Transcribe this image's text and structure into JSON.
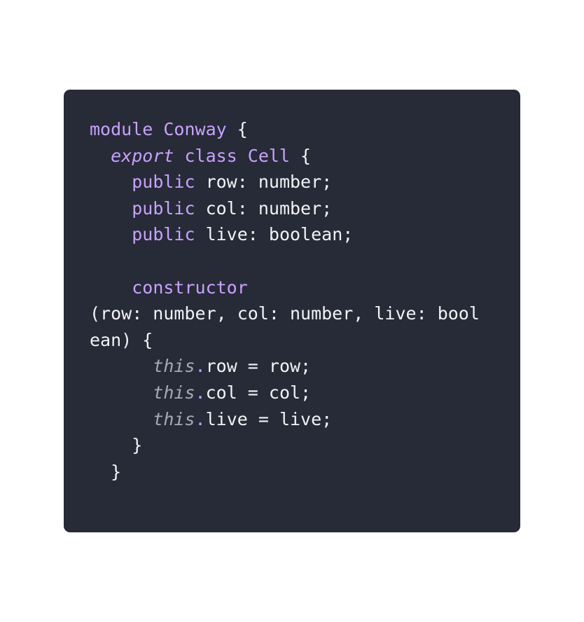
{
  "code": {
    "language": "typescript",
    "lines": [
      [
        {
          "t": "module",
          "c": "kw"
        },
        {
          "t": " ",
          "c": "plain"
        },
        {
          "t": "Conway",
          "c": "kw"
        },
        {
          "t": " {",
          "c": "plain"
        }
      ],
      [
        {
          "t": "  ",
          "c": "plain"
        },
        {
          "t": "export",
          "c": "kw-italic"
        },
        {
          "t": " class ",
          "c": "kw"
        },
        {
          "t": "Cell",
          "c": "kw"
        },
        {
          "t": " {",
          "c": "plain"
        }
      ],
      [
        {
          "t": "    ",
          "c": "plain"
        },
        {
          "t": "public",
          "c": "kw"
        },
        {
          "t": " row: number;",
          "c": "plain"
        }
      ],
      [
        {
          "t": "    ",
          "c": "plain"
        },
        {
          "t": "public",
          "c": "kw"
        },
        {
          "t": " col: number;",
          "c": "plain"
        }
      ],
      [
        {
          "t": "    ",
          "c": "plain"
        },
        {
          "t": "public",
          "c": "kw"
        },
        {
          "t": " live: boolean;",
          "c": "plain"
        }
      ],
      [],
      [
        {
          "t": "    ",
          "c": "plain"
        },
        {
          "t": "constructor",
          "c": "kw"
        }
      ],
      [
        {
          "t": "(row: number, col: number, live: bool",
          "c": "plain"
        }
      ],
      [
        {
          "t": "ean) {",
          "c": "plain"
        }
      ],
      [
        {
          "t": "      ",
          "c": "plain"
        },
        {
          "t": "this",
          "c": "this"
        },
        {
          "t": ".",
          "c": "dot"
        },
        {
          "t": "row = row;",
          "c": "plain"
        }
      ],
      [
        {
          "t": "      ",
          "c": "plain"
        },
        {
          "t": "this",
          "c": "this"
        },
        {
          "t": ".",
          "c": "dot"
        },
        {
          "t": "col = col;",
          "c": "plain"
        }
      ],
      [
        {
          "t": "      ",
          "c": "plain"
        },
        {
          "t": "this",
          "c": "this"
        },
        {
          "t": ".",
          "c": "dot"
        },
        {
          "t": "live = live;",
          "c": "plain"
        }
      ],
      [
        {
          "t": "    }",
          "c": "plain"
        }
      ],
      [
        {
          "t": "  }",
          "c": "plain"
        }
      ]
    ]
  },
  "colors": {
    "background": "#272a37",
    "keyword": "#c7a2ff",
    "text": "#f2f3f5",
    "this": "#a9a9b3"
  }
}
